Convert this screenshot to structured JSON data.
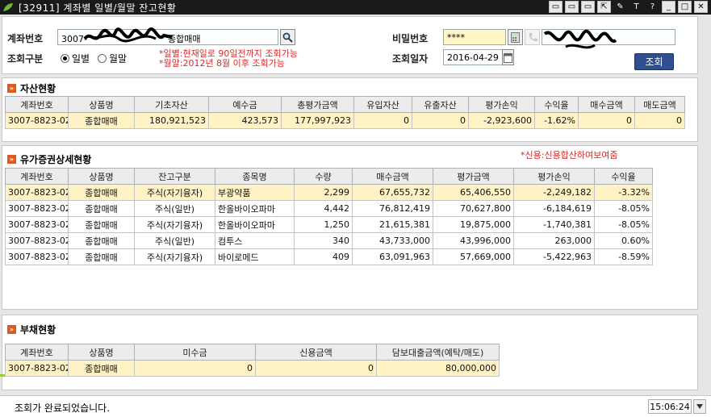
{
  "window": {
    "title": "[32911] 계좌별 일별/월말 잔고현황",
    "buttons": [
      "▭",
      "▭",
      "▭",
      "⇱",
      "✎",
      "T",
      "?",
      "_",
      "□",
      "✕"
    ]
  },
  "search": {
    "account_label": "계좌번호",
    "account_prefix": "3007-",
    "account_suffix": "종합매매",
    "password_label": "비밀번호",
    "password_value": "****",
    "period_label": "조회구분",
    "radio_daily": "일별",
    "radio_monthly": "월말",
    "note_line1": "*일별:현재일로 90일전까지 조회가능",
    "note_line2": "*월말:2012년 8월 이후 조회가능",
    "date_label": "조회일자",
    "date_value": "2016-04-29",
    "query_button": "조회"
  },
  "asset_section": {
    "title": "자산현황",
    "columns": [
      "계좌번호",
      "상품명",
      "기초자산",
      "예수금",
      "총평가금액",
      "유입자산",
      "유출자산",
      "평가손익",
      "수익율",
      "매수금액",
      "매도금액"
    ],
    "rows": [
      [
        "3007-8823-02",
        "종합매매",
        "180,921,523",
        "423,573",
        "177,997,923",
        "0",
        "0",
        "-2,923,600",
        "-1.62%",
        "0",
        "0"
      ]
    ]
  },
  "securities_section": {
    "title": "유가증권상세현황",
    "note": "*신용:신용합산하여보여줌",
    "columns": [
      "계좌번호",
      "상품명",
      "잔고구분",
      "종목명",
      "수량",
      "매수금액",
      "평가금액",
      "평가손익",
      "수익율"
    ],
    "rows": [
      [
        "3007-8823-02",
        "종합매매",
        "주식(자기융자)",
        "부광약품",
        "2,299",
        "67,655,732",
        "65,406,550",
        "-2,249,182",
        "-3.32%"
      ],
      [
        "3007-8823-02",
        "종합매매",
        "주식(일반)",
        "한올바이오파마",
        "4,442",
        "76,812,419",
        "70,627,800",
        "-6,184,619",
        "-8.05%"
      ],
      [
        "3007-8823-02",
        "종합매매",
        "주식(자기융자)",
        "한올바이오파마",
        "1,250",
        "21,615,381",
        "19,875,000",
        "-1,740,381",
        "-8.05%"
      ],
      [
        "3007-8823-02",
        "종합매매",
        "주식(일반)",
        "컴투스",
        "340",
        "43,733,000",
        "43,996,000",
        "263,000",
        "0.60%"
      ],
      [
        "3007-8823-02",
        "종합매매",
        "주식(자기융자)",
        "바이로메드",
        "409",
        "63,091,963",
        "57,669,000",
        "-5,422,963",
        "-8.59%"
      ]
    ]
  },
  "debt_section": {
    "title": "부채현황",
    "columns": [
      "계좌번호",
      "상품명",
      "미수금",
      "신용금액",
      "담보대출금액(예탁/매도)"
    ],
    "rows": [
      [
        "3007-8823-02",
        "종합매매",
        "0",
        "0",
        "80,000,000"
      ]
    ]
  },
  "status": {
    "message": "조회가 완료되었습니다.",
    "time": "15:06:24"
  },
  "colors": {
    "titlebar": "#1a1a1a",
    "selected_row": "#fff2c5",
    "note_red": "#d52b2b",
    "query_button": "#2f4f8f",
    "section_icon": "#e05a1e"
  }
}
